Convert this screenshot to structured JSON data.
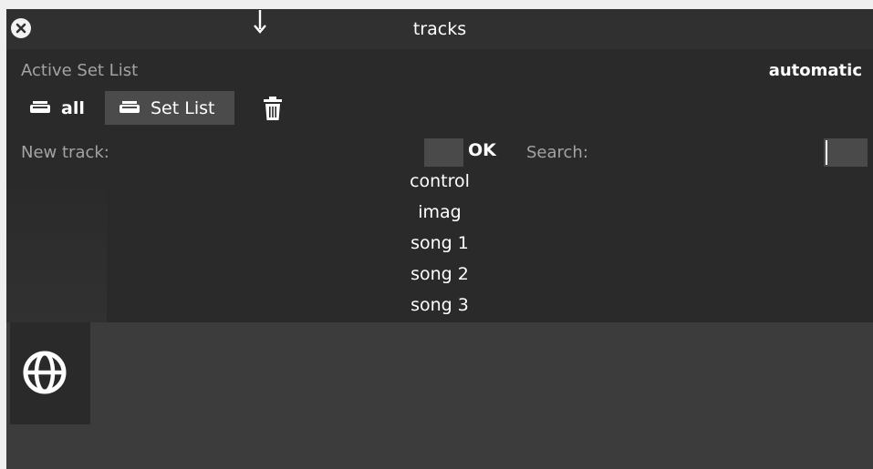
{
  "window": {
    "title": "tracks"
  },
  "header": {
    "active_label": "Active Set List",
    "mode": "automatic"
  },
  "tabs": [
    {
      "label": "all",
      "icon": "list-icon",
      "selected": false
    },
    {
      "label": "Set List",
      "icon": "list-icon",
      "selected": true
    }
  ],
  "new_track": {
    "label": "New track:",
    "value": "",
    "ok_label": "OK"
  },
  "search": {
    "label": "Search:",
    "value": ""
  },
  "tracks": [
    "control",
    "imag",
    "song 1",
    "song 2",
    "song 3"
  ],
  "colors": {
    "window_bg": "#3c3c3c",
    "panel_bg": "#2a2a2a",
    "selected_tab": "#4b4b4b",
    "text": "#ffffff",
    "muted_text": "#a3a3a3"
  }
}
